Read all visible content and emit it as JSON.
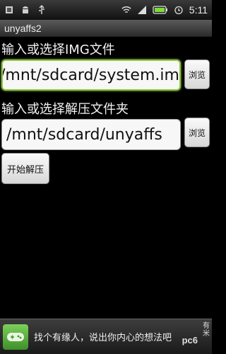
{
  "status_bar": {
    "time": "5:11",
    "icons": [
      "usb-icon",
      "android-icon",
      "usb-debug-icon",
      "wifi-icon",
      "signal-icon",
      "battery-icon",
      "alarm-icon"
    ]
  },
  "app": {
    "title": "unyaffs2"
  },
  "img_input": {
    "label": "输入或选择IMG文件",
    "value": "/mnt/sdcard/system.img",
    "browse_label": "浏览"
  },
  "out_input": {
    "label": "输入或选择解压文件夹",
    "value": "/mnt/sdcard/unyaffs",
    "browse_label": "浏览"
  },
  "start_button": {
    "label": "开始解压"
  },
  "ad": {
    "text": "找个有缘人，说出你内心的想法吧",
    "tag": "有米",
    "watermark": "pc6"
  },
  "colors": {
    "accent_focus": "#8cc63f",
    "battery": "#7ddc3a"
  }
}
